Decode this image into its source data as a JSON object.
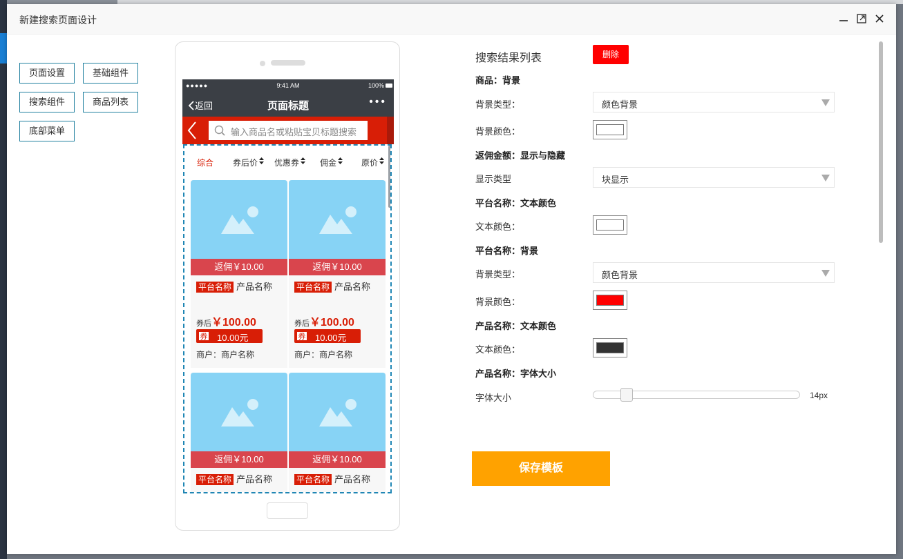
{
  "dialog": {
    "title": "新建搜索页面设计"
  },
  "components": {
    "page_settings": "页面设置",
    "basic_components": "基础组件",
    "search_component": "搜索组件",
    "product_list": "商品列表",
    "bottom_menu": "底部菜单"
  },
  "phone": {
    "status": {
      "signal": "●●●●● ",
      "time": "9:41 AM",
      "battery": "100%"
    },
    "nav": {
      "back": "返回",
      "title": "页面标题",
      "more": "•••"
    },
    "search": {
      "placeholder": "输入商品名或粘贴宝贝标题搜索"
    },
    "sort": [
      {
        "label": "综合",
        "active": true
      },
      {
        "label": "券后价",
        "active": false
      },
      {
        "label": "优惠券",
        "active": false
      },
      {
        "label": "佣金",
        "active": false
      },
      {
        "label": "原价",
        "active": false
      }
    ],
    "cards": [
      {
        "rebate": "返佣￥10.00",
        "platform": "平台名称",
        "name": "产品名称",
        "price_label": "券后",
        "price": "￥100.00",
        "coupon_tag": "券",
        "coupon": "10.00元",
        "shop": "商户：商户名称"
      },
      {
        "rebate": "返佣￥10.00",
        "platform": "平台名称",
        "name": "产品名称",
        "price_label": "券后",
        "price": "￥100.00",
        "coupon_tag": "券",
        "coupon": "10.00元",
        "shop": "商户：商户名称"
      },
      {
        "rebate": "返佣￥10.00",
        "platform": "平台名称",
        "name": "产品名称"
      },
      {
        "rebate": "返佣￥10.00",
        "platform": "平台名称",
        "name": "产品名称"
      }
    ]
  },
  "settings": {
    "title": "搜索结果列表",
    "delete": "删除",
    "goods_bg": "商品：背景",
    "bg_type_label": "背景类型：",
    "bg_type_value": "颜色背景",
    "bg_color_label": "背景颜色：",
    "rebate_head": "返佣金额：显示与隐藏",
    "display_type_label": "显示类型",
    "display_type_value": "块显示",
    "platform_text_head": "平台名称：文本颜色",
    "text_color_label": "文本颜色：",
    "platform_bg_head": "平台名称：背景",
    "platform_bg_type_label": "背景类型：",
    "platform_bg_type_value": "颜色背景",
    "platform_bg_color_label": "背景颜色：",
    "product_text_head": "产品名称：文本颜色",
    "product_text_color_label": "文本颜色：",
    "product_size_head": "产品名称：字体大小",
    "font_size_label": "字体大小",
    "font_size_value": "14px",
    "font_size_fraction": 0.14,
    "colors": {
      "goods_bg": "#ffffff",
      "platform_text": "#ffffff",
      "platform_bg": "#ff0000",
      "product_text": "#333333"
    }
  },
  "save": "保存模板"
}
